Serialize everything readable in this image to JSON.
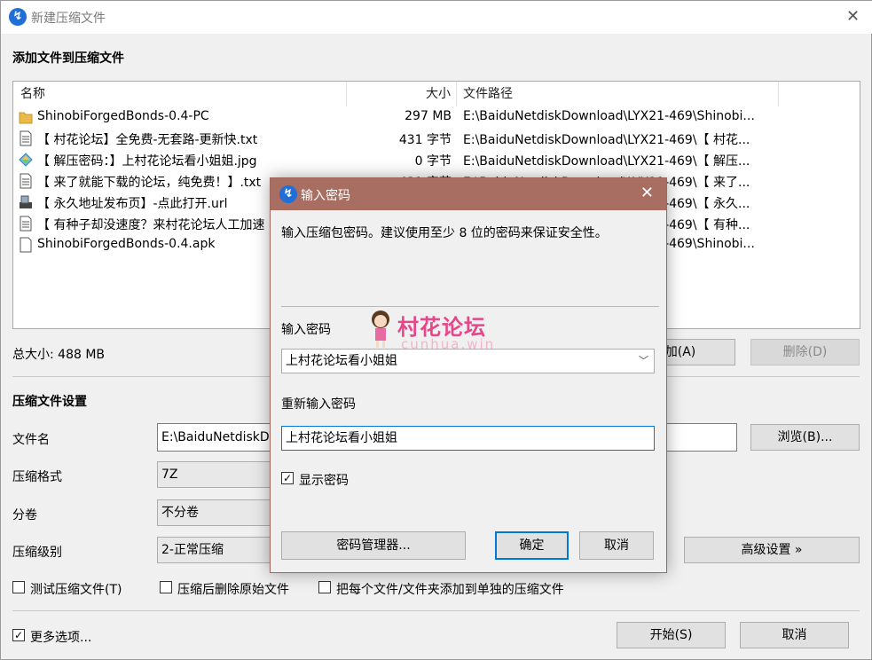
{
  "window": {
    "title": "新建压缩文件"
  },
  "add_section": {
    "heading": "添加文件到压缩文件"
  },
  "file_list": {
    "columns": [
      "名称",
      "大小",
      "文件路径"
    ],
    "rows": [
      {
        "name": "ShinobiForgedBonds-0.4-PC",
        "size": "297 MB",
        "path": "E:\\BaiduNetdiskDownload\\LYX21-469\\Shinobi...",
        "icon": "folder-icon"
      },
      {
        "name": "【 村花论坛】全免费-无套路-更新快.txt",
        "size": "431 字节",
        "path": "E:\\BaiduNetdiskDownload\\LYX21-469\\【 村花...",
        "icon": "text-file-icon"
      },
      {
        "name": "【 解压密码：】上村花论坛看小姐姐.jpg",
        "size": "0 字节",
        "path": "E:\\BaiduNetdiskDownload\\LYX21-469\\【 解压...",
        "icon": "image-file-icon"
      },
      {
        "name": "【 来了就能下载的论坛，纯免费！】.txt",
        "size": "431 字节",
        "path": "E:\\BaiduNetdiskDownload\\LYX21-469\\【 来了...",
        "icon": "text-file-icon"
      },
      {
        "name": "【 永久地址发布页】-点此打开.url",
        "size": "",
        "path": "E:\\BaiduNetdiskDownload\\LYX21-469\\【 永久...",
        "icon": "url-file-icon"
      },
      {
        "name": "【 有种子却没速度？来村花论坛人工加速",
        "size": "",
        "path": "E:\\BaiduNetdiskDownload\\LYX21-469\\【 有种...",
        "icon": "text-file-icon"
      },
      {
        "name": "ShinobiForgedBonds-0.4.apk",
        "size": "",
        "path": "E:\\BaiduNetdiskDownload\\LYX21-469\\Shinobi...",
        "icon": "file-icon"
      }
    ]
  },
  "summary": {
    "total_size": "总大小: 488 MB",
    "add_button": "添加(A)",
    "delete_button": "删除(D)"
  },
  "settings": {
    "heading": "压缩文件设置",
    "filename_label": "文件名",
    "filename_value": "E:\\BaiduNetdiskD",
    "browse_button": "浏览(B)...",
    "format_label": "压缩格式",
    "format_value": "7Z",
    "volume_label": "分卷",
    "volume_value": "不分卷",
    "level_label": "压缩级别",
    "level_value": "2-正常压缩",
    "advanced_button": "高级设置 »"
  },
  "options": {
    "test_archive": "测试压缩文件(T)",
    "delete_after": "压缩后删除原始文件",
    "separate_archives": "把每个文件/文件夹添加到单独的压缩文件",
    "more_options": "更多选项..."
  },
  "footer": {
    "start_button": "开始(S)",
    "cancel_button": "取消"
  },
  "password_dialog": {
    "title": "输入密码",
    "instruction": "输入压缩包密码。建议使用至少 8 位的密码来保证安全性。",
    "password_label": "输入密码",
    "password_value": "上村花论坛看小姐姐",
    "reenter_label": "重新输入密码",
    "reenter_value": "上村花论坛看小姐姐",
    "show_password": "显示密码",
    "manager_button": "密码管理器...",
    "ok_button": "确定",
    "cancel_button": "取消"
  },
  "watermark": {
    "title": "村花论坛",
    "subtitle": "cunhua.win"
  },
  "colors": {
    "dialog_title_bg": "#a86e62",
    "accent": "#0078d7",
    "app_icon": "#1f6fd6"
  }
}
